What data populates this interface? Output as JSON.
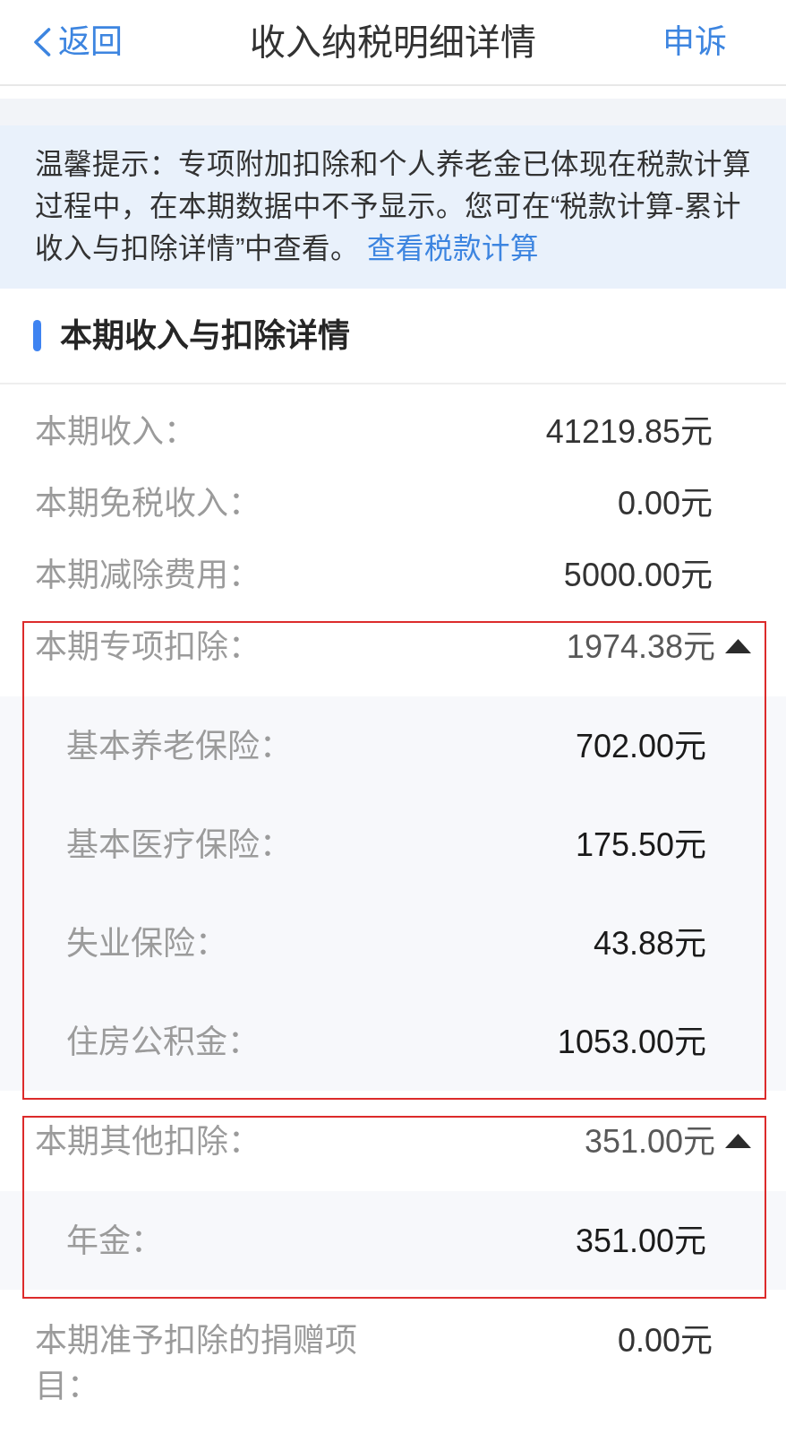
{
  "nav": {
    "back": "返回",
    "title": "收入纳税明细详情",
    "action": "申诉"
  },
  "notice": {
    "text": "温馨提示：专项附加扣除和个人养老金已体现在税款计算过程中，在本期数据中不予显示。您可在“税款计算-累计收入与扣除详情”中查看。",
    "link": "查看税款计算"
  },
  "section": {
    "title": "本期收入与扣除详情"
  },
  "rows": [
    {
      "kind": "plain",
      "label": "本期收入：",
      "value": "41219.85元"
    },
    {
      "kind": "plain",
      "label": "本期免税收入：",
      "value": "0.00元"
    },
    {
      "kind": "plain",
      "label": "本期减除费用：",
      "value": "5000.00元"
    },
    {
      "kind": "group",
      "label": "本期专项扣除：",
      "value": "1974.38元",
      "expanded": true,
      "highlighted": true,
      "children": [
        {
          "label": "基本养老保险：",
          "value": "702.00元"
        },
        {
          "label": "基本医疗保险：",
          "value": "175.50元"
        },
        {
          "label": "失业保险：",
          "value": "43.88元"
        },
        {
          "label": "住房公积金：",
          "value": "1053.00元"
        }
      ]
    },
    {
      "kind": "group",
      "label": "本期其他扣除：",
      "value": "351.00元",
      "expanded": true,
      "highlighted": true,
      "children": [
        {
          "label": "年金：",
          "value": "351.00元"
        }
      ]
    },
    {
      "kind": "plain",
      "label": "本期准予扣除的捐赠项目：",
      "value": "0.00元"
    }
  ]
}
